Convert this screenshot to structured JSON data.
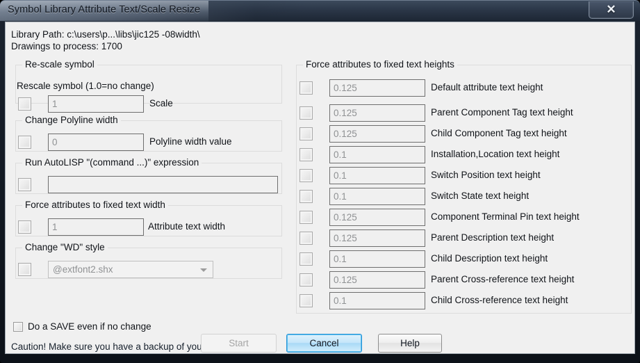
{
  "window": {
    "title": "Symbol Library Attribute Text/Scale Resize",
    "close_icon": "close-icon",
    "close_glyph": "✕"
  },
  "header": {
    "library_path": "Library Path: c:\\users\\p...\\libs\\jic125 -08width\\",
    "drawings_to_process": "Drawings to process: 1700"
  },
  "left_groups": [
    {
      "legend": "Re-scale symbol",
      "sub_label": "Rescale symbol (1.0=no change)",
      "value": "1",
      "label": "Scale"
    },
    {
      "legend": "Change Polyline width",
      "sub_label": "",
      "value": "0",
      "label": "Polyline width value"
    },
    {
      "legend": "Run AutoLISP \"(command ...)\" expression",
      "sub_label": "",
      "value": "",
      "label": ""
    },
    {
      "legend": "Force attributes to fixed text width",
      "sub_label": "",
      "value": "1",
      "label": "Attribute text width"
    },
    {
      "legend": "Change \"WD\" style",
      "sub_label": "",
      "value": "@extfont2.shx",
      "label": ""
    }
  ],
  "right_group": {
    "legend": "Force attributes to fixed text heights",
    "rows": [
      {
        "value": "0.125",
        "label": "Default attribute text height"
      },
      {
        "value": "0.125",
        "label": "Parent Component Tag text height"
      },
      {
        "value": "0.125",
        "label": "Child Component Tag text height"
      },
      {
        "value": "0.1",
        "label": "Installation,Location text height"
      },
      {
        "value": "0.1",
        "label": "Switch Position text height"
      },
      {
        "value": "0.1",
        "label": "Switch State text height"
      },
      {
        "value": "0.125",
        "label": "Component Terminal Pin text height"
      },
      {
        "value": "0.125",
        "label": "Parent Description text height"
      },
      {
        "value": "0.1",
        "label": "Child Description text height"
      },
      {
        "value": "0.125",
        "label": "Parent Cross-reference text height"
      },
      {
        "value": "0.1",
        "label": "Child Cross-reference text height"
      }
    ]
  },
  "footer": {
    "save_checkbox_label": "Do a SAVE even if no change",
    "caution_text": "Caution! Make sure you have a backup of your library!",
    "buttons": {
      "start": "Start",
      "cancel": "Cancel",
      "help": "Help"
    }
  },
  "colors": {
    "dialog_bg": "#f0f0f0",
    "default_button_accent": "#2c93d6",
    "titlebar_dark": "#1d2734",
    "disabled_text": "#8f9193"
  }
}
